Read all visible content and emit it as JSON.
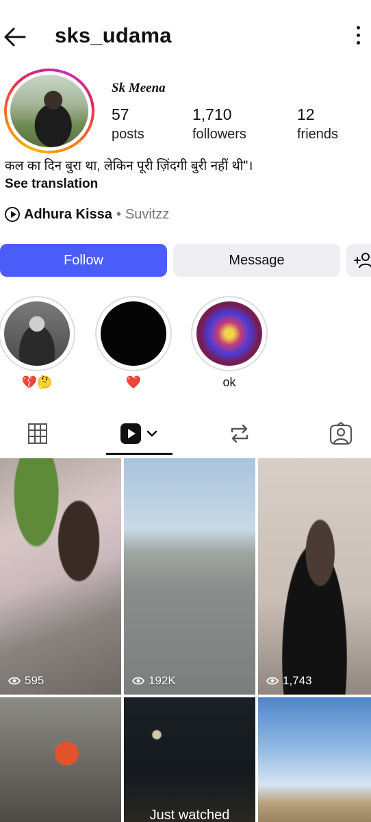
{
  "header": {
    "username": "sks_udama"
  },
  "profile": {
    "display_name": "Sk Meena",
    "stats": [
      {
        "value": "57",
        "label": "posts"
      },
      {
        "value": "1,710",
        "label": "followers"
      },
      {
        "value": "12",
        "label": "friends"
      }
    ],
    "bio": "कल का दिन बुरा था, लेकिन पूरी ज़िंदगी बुरी नहीं थी\"।",
    "see_translation": "See translation",
    "music": {
      "song": "Adhura Kissa",
      "separator": "•",
      "artist": "Suvitzz"
    }
  },
  "actions": {
    "follow": "Follow",
    "message": "Message"
  },
  "highlights": [
    {
      "label": "💔🤔"
    },
    {
      "label": "❤️"
    },
    {
      "label": "ok"
    }
  ],
  "tabs": {
    "items": [
      "grid-icon",
      "reels-icon",
      "repost-icon",
      "tagged-icon"
    ],
    "active": "reels-icon"
  },
  "grid": {
    "items": [
      {
        "views": "595"
      },
      {
        "views": "192K"
      },
      {
        "views": "1,743"
      },
      {
        "views": ""
      },
      {
        "views": "",
        "overlay": "Just watched"
      },
      {
        "views": ""
      }
    ]
  },
  "colors": {
    "follow_button": "#4a5df9",
    "secondary_button": "#efeff3"
  }
}
